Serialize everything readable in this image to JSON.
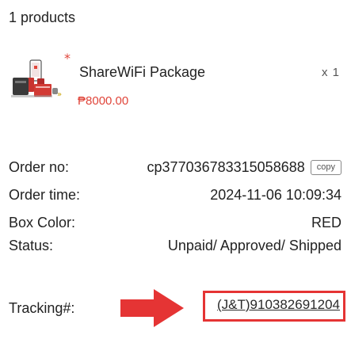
{
  "header": {
    "product_count": "1 products"
  },
  "product": {
    "name": "ShareWiFi Package",
    "quantity": "x 1",
    "price": "₱8000.00",
    "image_icon": "router-package-image"
  },
  "order": {
    "order_no_label": "Order no:",
    "order_no_value": "cp377036783315058688",
    "copy_label": "copy",
    "order_time_label": "Order time:",
    "order_time_value": "2024-11-06 10:09:34",
    "box_color_label": "Box Color:",
    "box_color_value": "RED",
    "status_label": "Status:",
    "status_value": "Unpaid/ Approved/ Shipped",
    "tracking_label": "Tracking#:",
    "tracking_value": "(J&T)910382691204"
  },
  "colors": {
    "price": "#e0453a",
    "annotation_red": "#e53434"
  }
}
